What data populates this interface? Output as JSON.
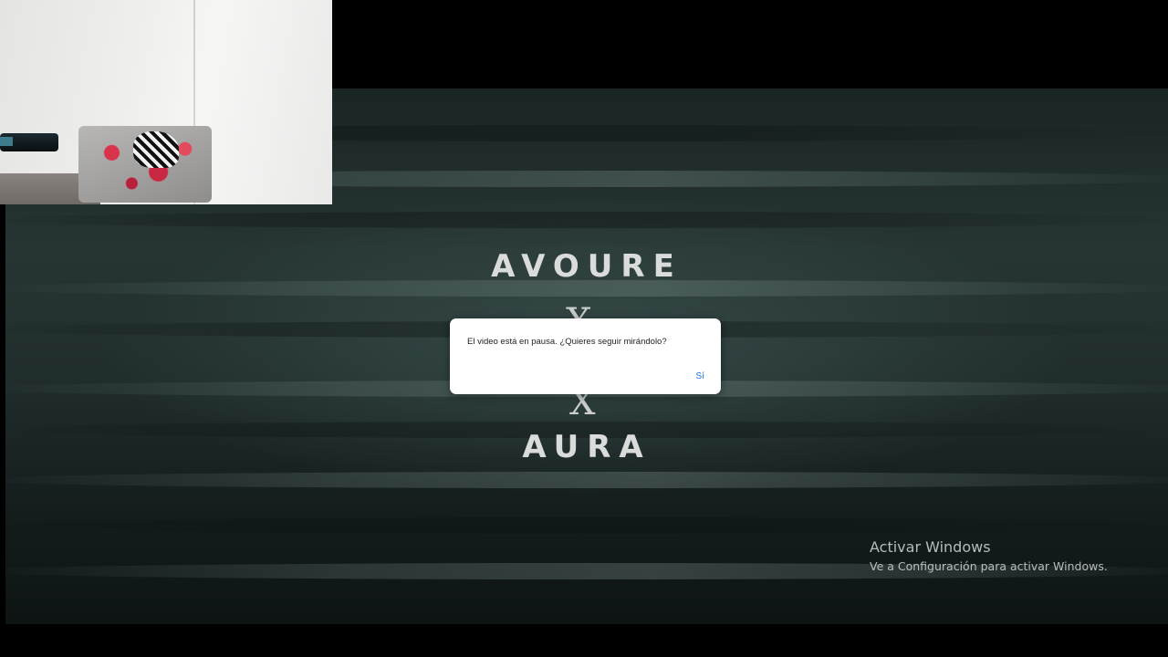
{
  "video": {
    "title_top": "AVOURE",
    "title_middle_glyph_top": "X",
    "title_middle_glyph_bottom": "X",
    "title_bottom": "AURA"
  },
  "dialog": {
    "message": "El video está en pausa. ¿Quieres seguir mirándolo?",
    "confirm_label": "Sí"
  },
  "watermark": {
    "title": "Activar Windows",
    "subtitle": "Ve a Configuración para activar Windows."
  },
  "colors": {
    "background": "#000000",
    "ocean": "#1f2b2a",
    "dialog_bg": "#ffffff",
    "dialog_button": "#1a73e8"
  }
}
